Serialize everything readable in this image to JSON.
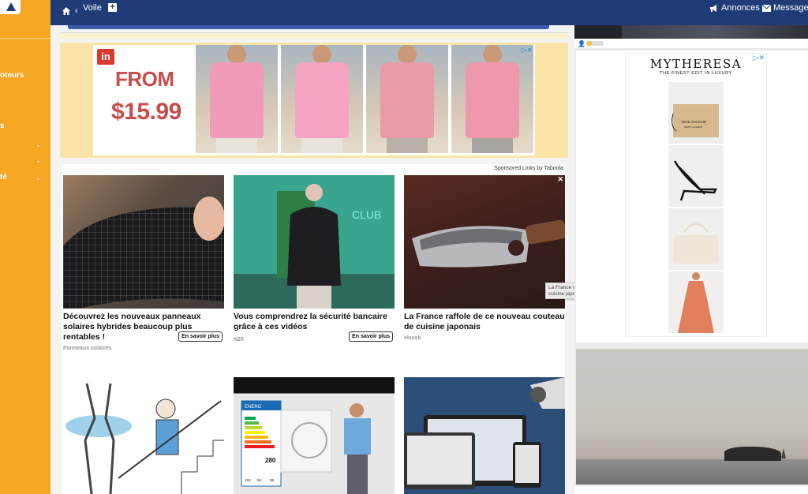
{
  "sidebar": {
    "items": [
      {
        "label": "oteurs"
      },
      {
        "label": "s"
      },
      {
        "label": "té"
      }
    ]
  },
  "topbar": {
    "breadcrumb": "Voile",
    "annonces": "Annonces",
    "messages": "Messages",
    "icons": [
      "home-icon",
      "chevron-left-icon",
      "plus-icon",
      "megaphone-icon",
      "envelope-icon"
    ]
  },
  "top_ad": {
    "logo": "in",
    "from": "FROM",
    "price": "$15.99"
  },
  "feed": {
    "sponsored": "Sponsored Links by Taboola",
    "cards": [
      {
        "title": "Découvrez les nouveaux panneaux solaires hybrides beaucoup plus rentables !",
        "source": "Panneaux solaires",
        "cta": "En savoir plus"
      },
      {
        "title": "Vous comprendrez la sécurité bancaire grâce à ces vidéos",
        "source": "N26",
        "cta": "En savoir plus"
      },
      {
        "title": "La France raffole de ce nouveau couteau de cuisine japonais",
        "source": "Huusk"
      }
    ],
    "tooltip": "La France raffole de ce nouveau couteau de cuisine japonais",
    "close": "✕",
    "neon_sign": "CLUB",
    "energy_label": {
      "title": "ENERG",
      "value": "280",
      "small_values": [
        "153",
        "54",
        "58"
      ]
    }
  },
  "right_ad": {
    "brand": "MYTHERESA",
    "tagline": "THE FINEST EDIT IN LUXURY",
    "pouch_text": "RIVE GAUCHE",
    "pouch_subtext": "SAINT LAURENT"
  },
  "colors": {
    "sidebar": "#f5a623",
    "topbar": "#1f3c78",
    "price": "#c84c4c"
  }
}
